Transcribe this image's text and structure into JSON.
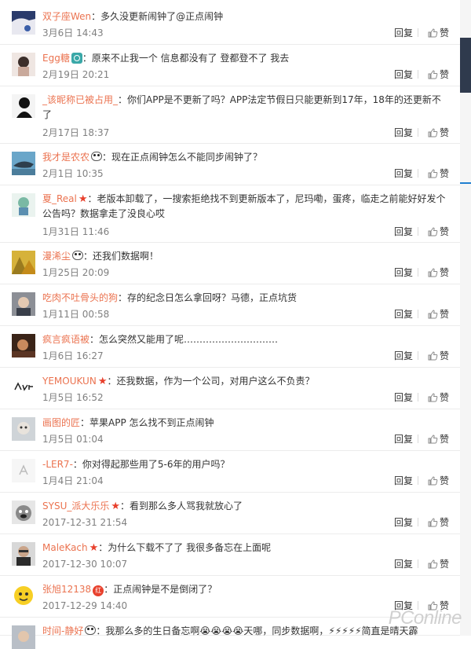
{
  "labels": {
    "reply": "回复",
    "like": "赞"
  },
  "brand_color": "#eb7350",
  "watermark": "PConline",
  "comments": [
    {
      "user": "双子座Wen",
      "badge": "",
      "text": "：多久没更新闹钟了@正点闹钟",
      "time": "3月6日 14:43"
    },
    {
      "user": "Egg糖",
      "badge": "vip",
      "text": "：原来不止我一个 信息都没有了 登都登不了 我去",
      "time": "2月19日 20:21"
    },
    {
      "user": "_该昵称已被占用_",
      "badge": "",
      "text": "：你们APP是不更新了吗？APP法定节假日只能更新到17年，18年的还更新不了",
      "time": "2月17日 18:37"
    },
    {
      "user": "我才是农农",
      "badge": "panda",
      "text": "：现在正点闹钟怎么不能同步闹钟了？",
      "time": "2月1日 10:35"
    },
    {
      "user": "夏_Real",
      "badge": "star",
      "text": "：老版本卸载了，一搜索拒绝找不到更新版本了，尼玛嘞，蛋疼，临走之前能好好发个公告吗？数据拿走了没良心哎",
      "time": "1月31日 11:46"
    },
    {
      "user": "漫浠尘",
      "badge": "panda",
      "text": "：还我们数据啊！",
      "time": "1月25日 20:09"
    },
    {
      "user": "吃肉不吐骨头的狗",
      "badge": "",
      "text": "：存的纪念日怎么拿回呀？马德，正点坑货",
      "time": "1月11日 00:58"
    },
    {
      "user": "疯言疯语被",
      "badge": "",
      "text": "：怎么突然又能用了呢…………………………",
      "time": "1月6日 16:27"
    },
    {
      "user": "YEMOUKUN",
      "badge": "star",
      "text": "：还我数据，作为一个公司，对用户这么不负责？",
      "time": "1月5日 16:52"
    },
    {
      "user": "画图的匠",
      "badge": "",
      "text": "：苹果APP 怎么找不到正点闹钟",
      "time": "1月5日 01:04"
    },
    {
      "user": "-LER7-",
      "badge": "",
      "text": "：你对得起那些用了5-6年的用户吗？",
      "time": "1月4日 21:04"
    },
    {
      "user": "SYSU_派大乐乐",
      "badge": "star",
      "text": "：看到那么多人骂我就放心了",
      "time": "2017-12-31 21:54"
    },
    {
      "user": "MaleKach",
      "badge": "star",
      "text": "：为什么下载不了了 我很多备忘在上面呢",
      "time": "2017-12-30 10:07"
    },
    {
      "user": "张旭12138",
      "badge": "red",
      "text": "：正点闹钟是不是倒闭了？",
      "time": "2017-12-29 14:40"
    },
    {
      "user": "时间-静好",
      "badge": "panda",
      "text": "：我那么多的生日备忘啊😭😭😭😭天哪，同步数据啊，⚡⚡⚡⚡⚡简直是晴天霹",
      "time": ""
    }
  ]
}
